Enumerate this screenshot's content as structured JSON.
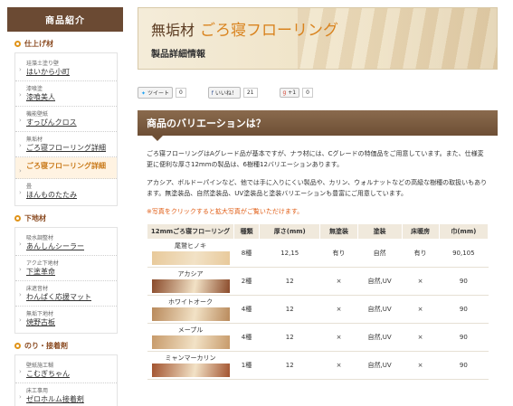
{
  "sidebar": {
    "header": "商品紹介",
    "sections": [
      {
        "title": "仕上げ材",
        "items": [
          {
            "sub": "珪藻土塗り壁",
            "name": "はいから小町",
            "active": false
          },
          {
            "sub": "漆喰塗",
            "name": "漆喰美人",
            "active": false
          },
          {
            "sub": "機能壁紙",
            "name": "すっぴんクロス",
            "active": false
          },
          {
            "sub": "無垢材",
            "name": "ごろ寝フローリング詳細",
            "active": false
          },
          {
            "sub": "",
            "name": "ごろ寝フローリング詳細",
            "active": true
          },
          {
            "sub": "畳",
            "name": "ほんものたたみ",
            "active": false
          }
        ]
      },
      {
        "title": "下地材",
        "items": [
          {
            "sub": "吸水調整材",
            "name": "あんしんシーラー",
            "active": false
          },
          {
            "sub": "アク止下地材",
            "name": "下塗革命",
            "active": false
          },
          {
            "sub": "床遮音材",
            "name": "わんぱく応援マット",
            "active": false
          },
          {
            "sub": "無垢下地材",
            "name": "焼野古板",
            "active": false
          }
        ]
      },
      {
        "title": "のり・接着剤",
        "items": [
          {
            "sub": "壁紙施工糊",
            "name": "こむぎちゃん",
            "active": false
          },
          {
            "sub": "床工事用",
            "name": "ゼロホルム接着剤",
            "active": false
          }
        ]
      }
    ]
  },
  "hero": {
    "title_prefix": "無垢材",
    "title_accent": "ごろ寝フローリング",
    "subtitle": "製品詳細情報"
  },
  "social": {
    "tweet_label": "ツイート",
    "tweet_count": "0",
    "like_label": "いいね！",
    "like_count": "21",
    "gplus_label": "+1",
    "gplus_count": "0"
  },
  "section_title": "商品のバリエーションは？",
  "paragraphs": [
    "ごろ寝フローリングはAグレード品が基本ですが、ナラ材には、Cグレードの特価品をご用意しています。また、仕様変更に便利な厚さ12mmの製品は、6樹種12バリエーションあります。",
    "アカシア、ボルドーパインなど、他では手に入りにくい製品や、カリン、ウォルナットなどの高級な樹種の取扱いもあります。無塗装品、自然塗装品、UV塗装品と塗装バリエーションも豊富にご用意しています。"
  ],
  "note": "※写真をクリックすると拡大写真がご覧いただけます。",
  "table": {
    "headers": [
      "12mmごろ寝フローリング",
      "種類",
      "厚さ(mm)",
      "無塗装",
      "塗装",
      "床暖房",
      "巾(mm)"
    ],
    "rows": [
      {
        "name": "尾鷲ヒノキ",
        "kinds": "8種",
        "thick": "12,15",
        "unpainted": "有り",
        "paint": "自然",
        "floorheat": "有り",
        "width": "90,105",
        "color": "#e8c99a"
      },
      {
        "name": "アカシア",
        "kinds": "2種",
        "thick": "12",
        "unpainted": "×",
        "paint": "自然,UV",
        "floorheat": "×",
        "width": "90",
        "color": "#8a4a2a"
      },
      {
        "name": "ホワイトオーク",
        "kinds": "4種",
        "thick": "12",
        "unpainted": "×",
        "paint": "自然,UV",
        "floorheat": "×",
        "width": "90",
        "color": "#b98a5c"
      },
      {
        "name": "メープル",
        "kinds": "4種",
        "thick": "12",
        "unpainted": "×",
        "paint": "自然,UV",
        "floorheat": "×",
        "width": "90",
        "color": "#c79a6a"
      },
      {
        "name": "ミャンマーカリン",
        "kinds": "1種",
        "thick": "12",
        "unpainted": "×",
        "paint": "自然,UV",
        "floorheat": "×",
        "width": "90",
        "color": "#a2532f"
      }
    ]
  }
}
